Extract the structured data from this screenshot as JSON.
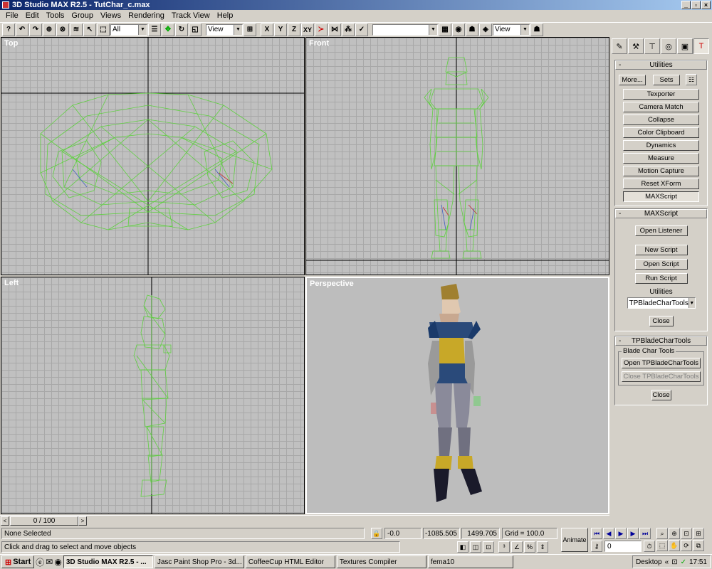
{
  "window": {
    "title": "3D Studio MAX R2.5 - TutChar_c.max",
    "min": "_",
    "max": "▫",
    "close": "×"
  },
  "menu": [
    "File",
    "Edit",
    "Tools",
    "Group",
    "Views",
    "Rendering",
    "Track View",
    "Help"
  ],
  "toolbar": {
    "selection_filter": "All",
    "ref_coord": "View",
    "axis_x": "X",
    "axis_y": "Y",
    "axis_z": "Z",
    "axis_xy": "XY",
    "named_selection": "",
    "render_view": "View"
  },
  "viewports": {
    "top": "Top",
    "front": "Front",
    "left": "Left",
    "perspective": "Perspective"
  },
  "command_panel": {
    "utilities": {
      "title": "Utilities",
      "more": "More...",
      "sets": "Sets",
      "buttons": [
        "Texporter",
        "Camera Match",
        "Collapse",
        "Color Clipboard",
        "Dynamics",
        "Measure",
        "Motion Capture",
        "Reset XForm",
        "MAXScript"
      ]
    },
    "maxscript": {
      "title": "MAXScript",
      "open_listener": "Open Listener",
      "new_script": "New Script",
      "open_script": "Open Script",
      "run_script": "Run Script",
      "utilities_label": "Utilities",
      "utilities_value": "TPBladeCharTools",
      "close": "Close"
    },
    "tpblade": {
      "title": "TPBladeCharTools",
      "group": "Blade Char Tools",
      "open": "Open TPBladeCharTools",
      "close_tool": "Close TPBladeCharTools",
      "close": "Close"
    }
  },
  "time_slider": {
    "label": "0 / 100",
    "prev": "<",
    "next": ">"
  },
  "status": {
    "selection": "None Selected",
    "prompt": "Click and drag to select and move objects",
    "x": "-0.0",
    "y": "-1085.505",
    "z": "1499.705",
    "grid": "Grid = 100.0",
    "animate": "Animate",
    "frame": "0"
  },
  "taskbar": {
    "start": "Start",
    "tasks": [
      "3D Studio MAX R2.5 - ...",
      "Jasc Paint Shop Pro - 3d...",
      "CoffeeCup HTML Editor",
      "Textures Compiler",
      "fema10"
    ],
    "desktop": "Desktop",
    "clock": "17:51"
  },
  "colors": {
    "wire": "#5fd040",
    "title_start": "#0a246a",
    "viewport_bg": "#c0c0c0"
  }
}
